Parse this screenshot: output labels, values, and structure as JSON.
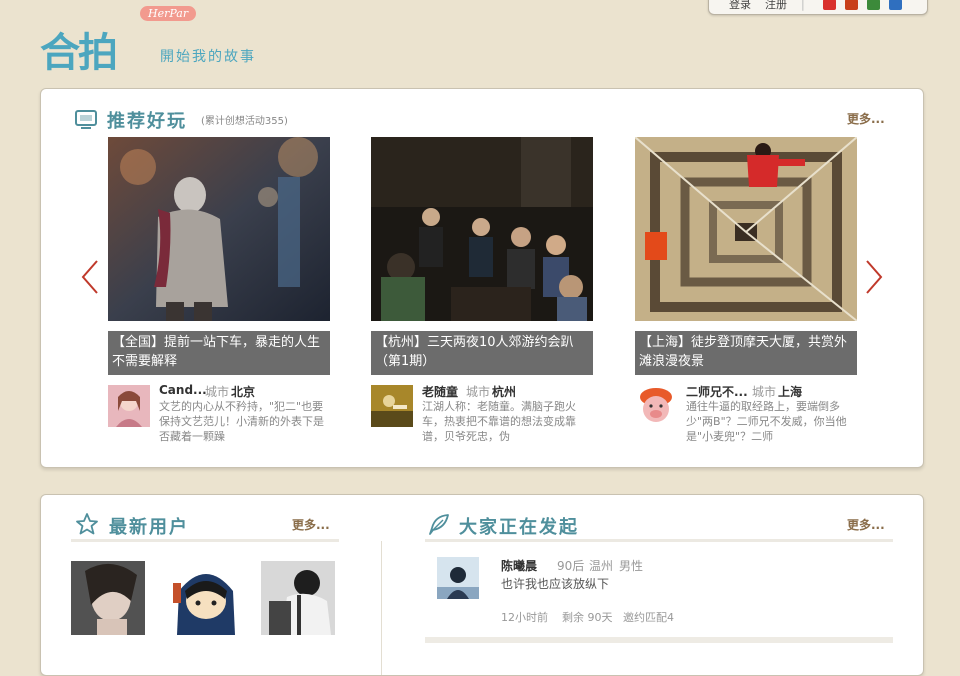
{
  "topbar": {
    "login": "登录",
    "register": "注册",
    "social_icons": [
      {
        "name": "weibo-icon",
        "color": "#d9302c"
      },
      {
        "name": "tencent-weibo-icon",
        "color": "#c8401a"
      },
      {
        "name": "douban-icon",
        "color": "#3c8a3a"
      },
      {
        "name": "qq-space-icon",
        "color": "#2f6fbf"
      }
    ]
  },
  "logo": {
    "text": "合拍",
    "badge": "HerPar",
    "slogan": "開始我的故事"
  },
  "recommend": {
    "title": "推荐好玩",
    "note": "(累计创想活动355)",
    "more": "更多...",
    "cards": [
      {
        "caption": "【全国】提前一站下车，暴走的人生不需要解释",
        "user": "Cand...",
        "city_label": "城市",
        "city": "北京",
        "bio": "文艺的内心从不矜持，\"犯二\"也要保持文艺范儿！小清新的外表下是否藏着一颗躁"
      },
      {
        "caption": "【杭州】三天两夜10人郊游约会趴（第1期）",
        "user": "老随童",
        "city_label": "城市",
        "city": "杭州",
        "bio": "江湖人称：老随童。满脑子跑火车，热衷把不靠谱的想法变成靠谱，贝爷死忠，伪"
      },
      {
        "caption": "【上海】徒步登顶摩天大厦，共赏外滩浪漫夜景",
        "user": "二师兄不...",
        "city_label": "城市",
        "city": "上海",
        "bio": "通往牛逼的取经路上，要端倒多少\"两B\"？二师兄不发威，你当他是\"小麦兜\"？二师"
      }
    ]
  },
  "new_users": {
    "title": "最新用户",
    "more": "更多..."
  },
  "initiating": {
    "title": "大家正在发起",
    "more": "更多...",
    "item": {
      "name": "陈曦晨",
      "age": "90后",
      "city": "温州",
      "gender": "男性",
      "text": "也许我也应该放纵下",
      "time": "12小时前",
      "remaining": "剩余 90天",
      "invite": "邀约匹配4"
    }
  },
  "colors": {
    "background": "#ebe3cf",
    "accent_teal": "#4f8f9c",
    "logo_blue": "#4ca6bf",
    "more_brown": "#8a6d4a",
    "caption_bg": "#6c6c6c",
    "arrow_red": "#c0392b"
  }
}
